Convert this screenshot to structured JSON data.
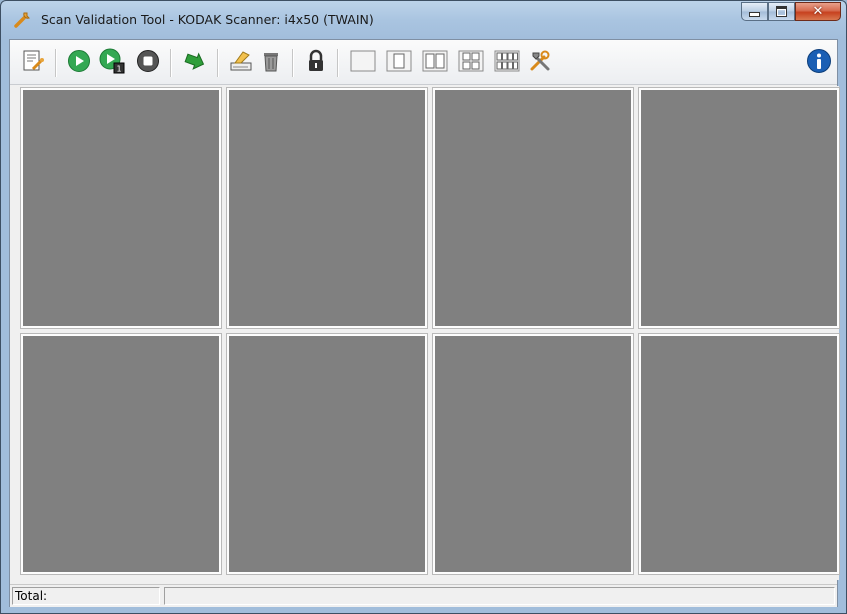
{
  "window": {
    "title": "Scan Validation Tool - KODAK Scanner: i4x50 (TWAIN)",
    "caption_buttons": [
      "minimize",
      "maximize",
      "close"
    ]
  },
  "toolbar": {
    "buttons": [
      {
        "name": "setup-icon"
      },
      {
        "name": "start-scan-icon",
        "color": "#2ea043"
      },
      {
        "name": "scan-one-page-icon",
        "color": "#2ea043"
      },
      {
        "name": "stop-scan-icon"
      },
      {
        "name": "go-to-next-icon",
        "color": "#2e9a2e"
      },
      {
        "name": "image-address-icon"
      },
      {
        "name": "delete-icon"
      },
      {
        "name": "lock-icon"
      },
      {
        "name": "no-images-view-icon"
      },
      {
        "name": "one-image-view-icon"
      },
      {
        "name": "two-images-view-icon"
      },
      {
        "name": "four-images-view-icon"
      },
      {
        "name": "eight-images-view-icon"
      },
      {
        "name": "tools-icon"
      },
      {
        "name": "about-icon",
        "color": "#1a5fb4"
      }
    ]
  },
  "viewer": {
    "cell_color": "#808080",
    "cell_count": 8
  },
  "status": {
    "total_label": "Total:",
    "message": ""
  }
}
